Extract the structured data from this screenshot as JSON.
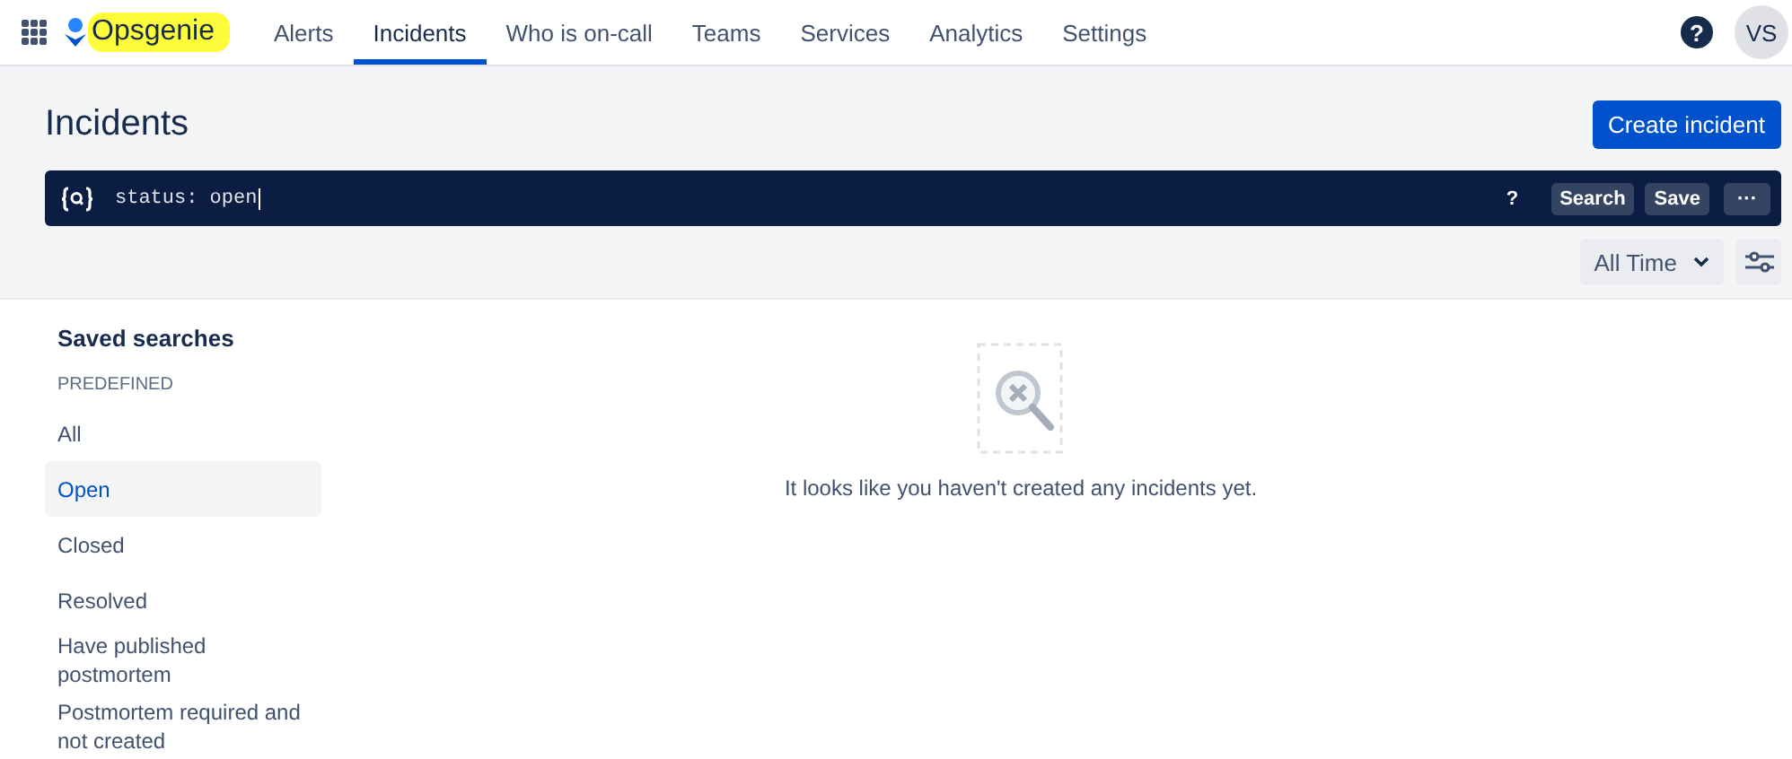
{
  "header": {
    "logo": "Opsgenie",
    "nav": [
      {
        "label": "Alerts",
        "selected": false
      },
      {
        "label": "Incidents",
        "selected": true
      },
      {
        "label": "Who is on-call",
        "selected": false
      },
      {
        "label": "Teams",
        "selected": false
      },
      {
        "label": "Services",
        "selected": false
      },
      {
        "label": "Analytics",
        "selected": false
      },
      {
        "label": "Settings",
        "selected": false
      }
    ],
    "help": "?",
    "avatar": "VS"
  },
  "page": {
    "title": "Incidents",
    "create_button": "Create incident"
  },
  "search": {
    "value": "status: open",
    "help": "?",
    "search_button": "Search",
    "save_button": "Save",
    "more_button": "···"
  },
  "filter": {
    "time_range": "All Time"
  },
  "sidebar": {
    "title": "Saved searches",
    "section": "PREDEFINED",
    "items": [
      {
        "label": "All",
        "selected": false
      },
      {
        "label": "Open",
        "selected": true
      },
      {
        "label": "Closed",
        "selected": false
      },
      {
        "label": "Resolved",
        "selected": false
      },
      {
        "label": "Have published postmortem",
        "selected": false
      },
      {
        "label": "Postmortem required and not created",
        "selected": false
      }
    ]
  },
  "empty_state": {
    "message": "It looks like you haven't created any incidents yet."
  }
}
